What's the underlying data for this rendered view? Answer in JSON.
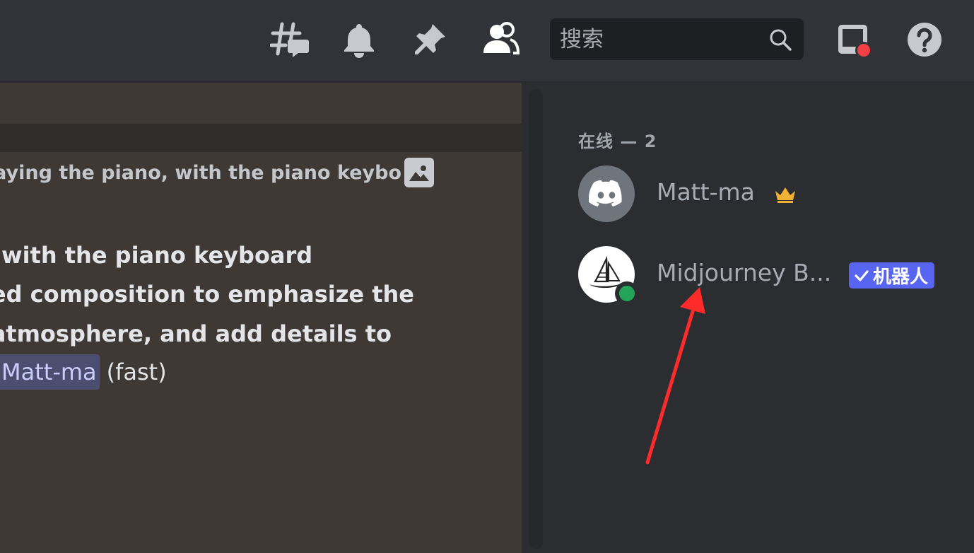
{
  "header": {
    "search_placeholder": "搜索",
    "icons": [
      "threads-icon",
      "bell-icon",
      "pin-icon",
      "members-icon",
      "search-icon",
      "inbox-icon",
      "help-icon"
    ]
  },
  "chat": {
    "reply_preview": "aying the piano, with the piano keybo",
    "message_lines": [
      "with the piano keyboard",
      "ced composition to emphasize the",
      " atmosphere, and add details to"
    ],
    "mention": "Matt-ma",
    "speed": "(fast)"
  },
  "members": {
    "group_header": "在线 — 2",
    "list": [
      {
        "name": "Matt-ma",
        "avatar": "discord-icon",
        "badge": "crown-icon"
      },
      {
        "name": "Midjourney B...",
        "avatar": "midjourney-boat-icon",
        "status": "online",
        "bot_label": "机器人"
      }
    ]
  },
  "colors": {
    "header_bg": "#313338",
    "chat_bg": "#3e3934",
    "members_bg": "#2b2d31",
    "bot_badge": "#5865f2",
    "online": "#23a559",
    "notification_dot": "#f23f43",
    "arrow": "#ff2a2a",
    "crown": "#f0b232"
  }
}
